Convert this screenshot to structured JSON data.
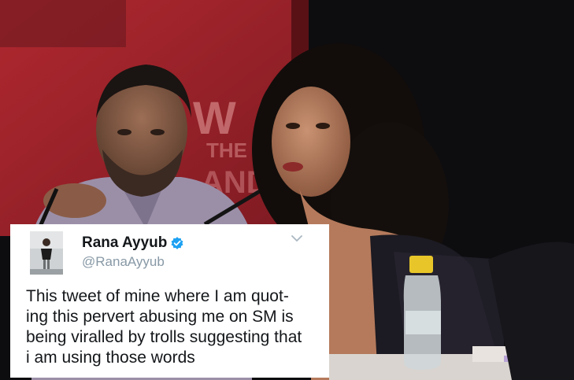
{
  "tweet": {
    "display_name": "Rana Ayyub",
    "handle": "@RanaAyyub",
    "verified": true,
    "text_lines": [
      "This tweet of mine where I am quot-",
      "ing this pervert abusing me on  SM is",
      "being viralled by trolls suggesting that",
      "i am using those words"
    ]
  },
  "photo": {
    "backdrop_lettering": [
      "W",
      "THE",
      "AND"
    ],
    "colors": {
      "backdrop_red": "#a3242c",
      "stage_dark": "#0d0d10",
      "skin": "#b57a5c",
      "shirt": "#9b8fa8",
      "bottle_cap": "#e8c629"
    }
  },
  "colors": {
    "card_background": "#ffffff",
    "name_text": "#14171a",
    "handle_text": "#8899a6",
    "verified_badge": "#1da1f2"
  },
  "icons": {
    "verified": "verified-badge-icon",
    "menu": "chevron-down-icon"
  }
}
